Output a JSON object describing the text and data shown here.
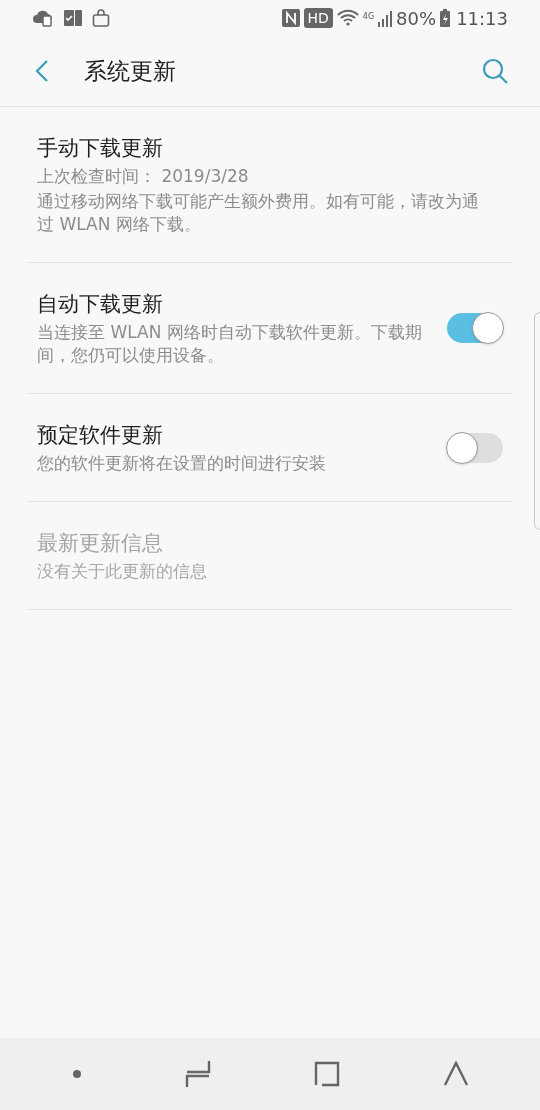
{
  "status_bar": {
    "hd": "HD",
    "network": "4G",
    "battery": "80%",
    "time": "11:13"
  },
  "header": {
    "title": "系统更新"
  },
  "items": [
    {
      "kind": "plain",
      "title": "手动下载更新",
      "subtitles": [
        "上次检查时间： 2019/3/28",
        "通过移动网络下载可能产生额外费用。如有可能，请改为通过 WLAN 网络下载。"
      ],
      "disabled": false
    },
    {
      "kind": "toggle",
      "title": "自动下载更新",
      "subtitles": [
        "当连接至 WLAN 网络时自动下载软件更新。下载期间，您仍可以使用设备。"
      ],
      "on": true,
      "disabled": false
    },
    {
      "kind": "toggle",
      "title": "预定软件更新",
      "subtitles": [
        "您的软件更新将在设置的时间进行安装"
      ],
      "on": false,
      "disabled": false
    },
    {
      "kind": "plain",
      "title": "最新更新信息",
      "subtitles": [
        "没有关于此更新的信息"
      ],
      "disabled": true
    }
  ]
}
